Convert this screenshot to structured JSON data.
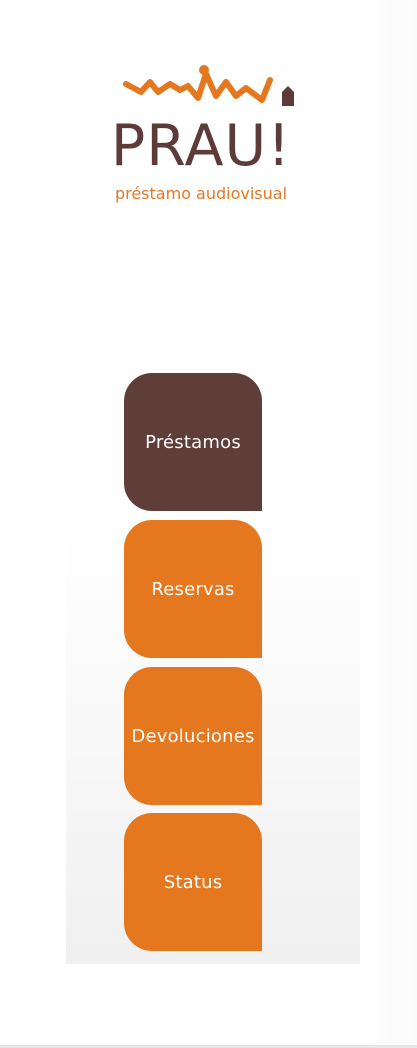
{
  "logo": {
    "title": "PRAU!",
    "subtitle": "préstamo audiovisual"
  },
  "menu": [
    {
      "label": "Préstamos",
      "variant": "dark"
    },
    {
      "label": "Reservas",
      "variant": "orange"
    },
    {
      "label": "Devoluciones",
      "variant": "orange"
    },
    {
      "label": "Status",
      "variant": "orange"
    }
  ],
  "colors": {
    "brand_brown": "#5f3d39",
    "brand_orange": "#e5771e"
  }
}
